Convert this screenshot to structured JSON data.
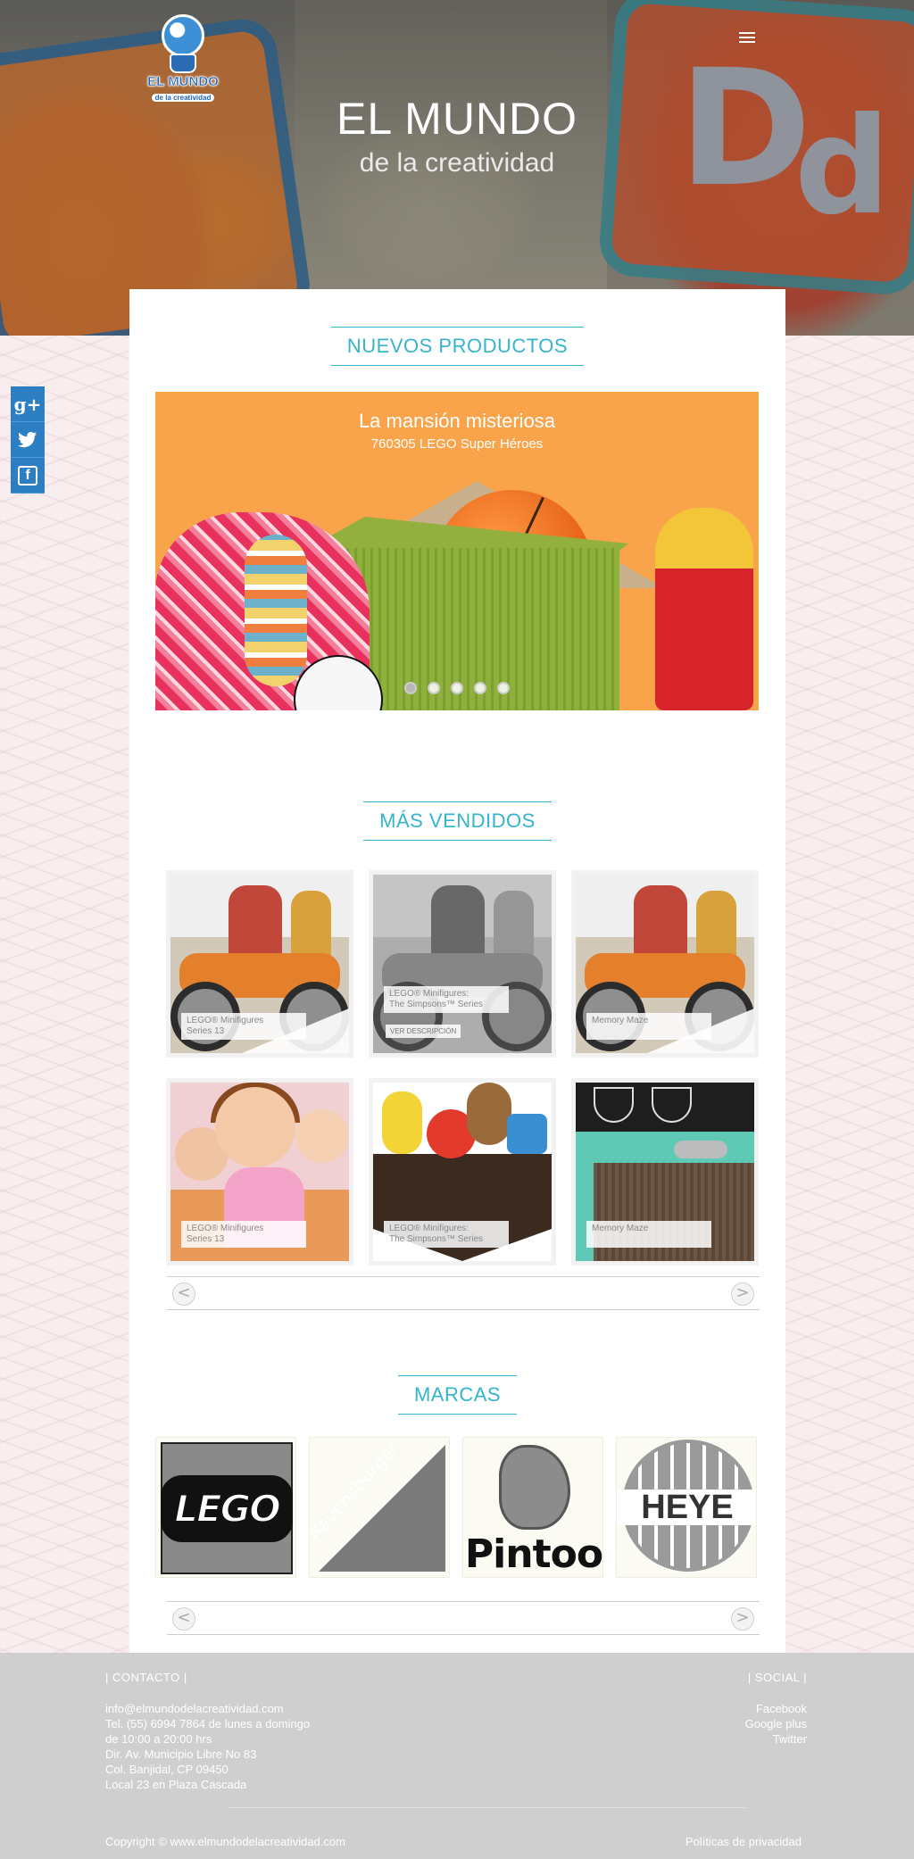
{
  "hero": {
    "title": "EL MUNDO",
    "subtitle": "de la creatividad",
    "logo_text": "EL MUNDO",
    "logo_sub": "de la creatividad"
  },
  "social_sidebar": {
    "google_plus": "g+",
    "twitter": "t",
    "facebook": "f"
  },
  "new_products": {
    "heading": "NUEVOS PRODUCTOS",
    "slide": {
      "title": "La mansión misteriosa",
      "subtitle": "760305 LEGO Super Héroes"
    },
    "slide_count": 5,
    "active_slide": 1
  },
  "best_sellers": {
    "heading": "MÁS VENDIDOS",
    "items": [
      {
        "label_line1": "LEGO® Minifigures",
        "label_line2": "Series 13"
      },
      {
        "label_line1": "LEGO® Minifigures:",
        "label_line2": "The Simpsons™ Series",
        "button": "VER DESCRIPCIÓN"
      },
      {
        "label_line1": "Memory Maze",
        "label_line2": ""
      },
      {
        "label_line1": "LEGO® Minifigures",
        "label_line2": "Series 13"
      },
      {
        "label_line1": "LEGO® Minifigures:",
        "label_line2": "The Simpsons™ Series"
      },
      {
        "label_line1": "Memory Maze",
        "label_line2": ""
      }
    ],
    "prev": "<",
    "next": ">"
  },
  "brands": {
    "heading": "MARCAS",
    "items": [
      "LEGO",
      "Ravensburger",
      "Pintoo",
      "HEYE"
    ],
    "prev": "<",
    "next": ">"
  },
  "footer": {
    "contact_heading": "|  CONTACTO  |",
    "contact_lines": [
      "info@elmundodelacreatividad.com",
      "Tel. (55) 6994 7864 de lunes a domingo",
      "de 10:00 a 20:00 hrs",
      "Dir. Av. Municipio Libre No 83",
      "Col. Banjidal, CP 09450",
      "Local 23 en Plaza Cascada"
    ],
    "social_heading": "|  SOCIAL  |",
    "social_links": [
      "Facebook",
      "Google plus",
      "Twitter"
    ],
    "copyright": "Copyright © www.elmundodelacreatividad.com",
    "privacy": "Políticas de privacidad"
  },
  "colors": {
    "accent": "#35b4cf",
    "slider_bg": "#f9a44a",
    "social_blue": "#2d7fc4",
    "footer_bg": "#cfcfcf"
  }
}
